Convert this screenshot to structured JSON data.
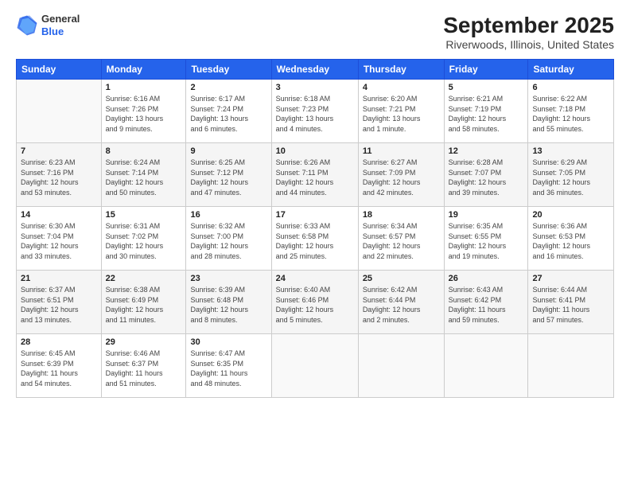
{
  "logo": {
    "line1": "General",
    "line2": "Blue"
  },
  "title": "September 2025",
  "subtitle": "Riverwoods, Illinois, United States",
  "days_of_week": [
    "Sunday",
    "Monday",
    "Tuesday",
    "Wednesday",
    "Thursday",
    "Friday",
    "Saturday"
  ],
  "weeks": [
    [
      {
        "day": "",
        "info": ""
      },
      {
        "day": "1",
        "info": "Sunrise: 6:16 AM\nSunset: 7:26 PM\nDaylight: 13 hours\nand 9 minutes."
      },
      {
        "day": "2",
        "info": "Sunrise: 6:17 AM\nSunset: 7:24 PM\nDaylight: 13 hours\nand 6 minutes."
      },
      {
        "day": "3",
        "info": "Sunrise: 6:18 AM\nSunset: 7:23 PM\nDaylight: 13 hours\nand 4 minutes."
      },
      {
        "day": "4",
        "info": "Sunrise: 6:20 AM\nSunset: 7:21 PM\nDaylight: 13 hours\nand 1 minute."
      },
      {
        "day": "5",
        "info": "Sunrise: 6:21 AM\nSunset: 7:19 PM\nDaylight: 12 hours\nand 58 minutes."
      },
      {
        "day": "6",
        "info": "Sunrise: 6:22 AM\nSunset: 7:18 PM\nDaylight: 12 hours\nand 55 minutes."
      }
    ],
    [
      {
        "day": "7",
        "info": "Sunrise: 6:23 AM\nSunset: 7:16 PM\nDaylight: 12 hours\nand 53 minutes."
      },
      {
        "day": "8",
        "info": "Sunrise: 6:24 AM\nSunset: 7:14 PM\nDaylight: 12 hours\nand 50 minutes."
      },
      {
        "day": "9",
        "info": "Sunrise: 6:25 AM\nSunset: 7:12 PM\nDaylight: 12 hours\nand 47 minutes."
      },
      {
        "day": "10",
        "info": "Sunrise: 6:26 AM\nSunset: 7:11 PM\nDaylight: 12 hours\nand 44 minutes."
      },
      {
        "day": "11",
        "info": "Sunrise: 6:27 AM\nSunset: 7:09 PM\nDaylight: 12 hours\nand 42 minutes."
      },
      {
        "day": "12",
        "info": "Sunrise: 6:28 AM\nSunset: 7:07 PM\nDaylight: 12 hours\nand 39 minutes."
      },
      {
        "day": "13",
        "info": "Sunrise: 6:29 AM\nSunset: 7:05 PM\nDaylight: 12 hours\nand 36 minutes."
      }
    ],
    [
      {
        "day": "14",
        "info": "Sunrise: 6:30 AM\nSunset: 7:04 PM\nDaylight: 12 hours\nand 33 minutes."
      },
      {
        "day": "15",
        "info": "Sunrise: 6:31 AM\nSunset: 7:02 PM\nDaylight: 12 hours\nand 30 minutes."
      },
      {
        "day": "16",
        "info": "Sunrise: 6:32 AM\nSunset: 7:00 PM\nDaylight: 12 hours\nand 28 minutes."
      },
      {
        "day": "17",
        "info": "Sunrise: 6:33 AM\nSunset: 6:58 PM\nDaylight: 12 hours\nand 25 minutes."
      },
      {
        "day": "18",
        "info": "Sunrise: 6:34 AM\nSunset: 6:57 PM\nDaylight: 12 hours\nand 22 minutes."
      },
      {
        "day": "19",
        "info": "Sunrise: 6:35 AM\nSunset: 6:55 PM\nDaylight: 12 hours\nand 19 minutes."
      },
      {
        "day": "20",
        "info": "Sunrise: 6:36 AM\nSunset: 6:53 PM\nDaylight: 12 hours\nand 16 minutes."
      }
    ],
    [
      {
        "day": "21",
        "info": "Sunrise: 6:37 AM\nSunset: 6:51 PM\nDaylight: 12 hours\nand 13 minutes."
      },
      {
        "day": "22",
        "info": "Sunrise: 6:38 AM\nSunset: 6:49 PM\nDaylight: 12 hours\nand 11 minutes."
      },
      {
        "day": "23",
        "info": "Sunrise: 6:39 AM\nSunset: 6:48 PM\nDaylight: 12 hours\nand 8 minutes."
      },
      {
        "day": "24",
        "info": "Sunrise: 6:40 AM\nSunset: 6:46 PM\nDaylight: 12 hours\nand 5 minutes."
      },
      {
        "day": "25",
        "info": "Sunrise: 6:42 AM\nSunset: 6:44 PM\nDaylight: 12 hours\nand 2 minutes."
      },
      {
        "day": "26",
        "info": "Sunrise: 6:43 AM\nSunset: 6:42 PM\nDaylight: 11 hours\nand 59 minutes."
      },
      {
        "day": "27",
        "info": "Sunrise: 6:44 AM\nSunset: 6:41 PM\nDaylight: 11 hours\nand 57 minutes."
      }
    ],
    [
      {
        "day": "28",
        "info": "Sunrise: 6:45 AM\nSunset: 6:39 PM\nDaylight: 11 hours\nand 54 minutes."
      },
      {
        "day": "29",
        "info": "Sunrise: 6:46 AM\nSunset: 6:37 PM\nDaylight: 11 hours\nand 51 minutes."
      },
      {
        "day": "30",
        "info": "Sunrise: 6:47 AM\nSunset: 6:35 PM\nDaylight: 11 hours\nand 48 minutes."
      },
      {
        "day": "",
        "info": ""
      },
      {
        "day": "",
        "info": ""
      },
      {
        "day": "",
        "info": ""
      },
      {
        "day": "",
        "info": ""
      }
    ]
  ]
}
